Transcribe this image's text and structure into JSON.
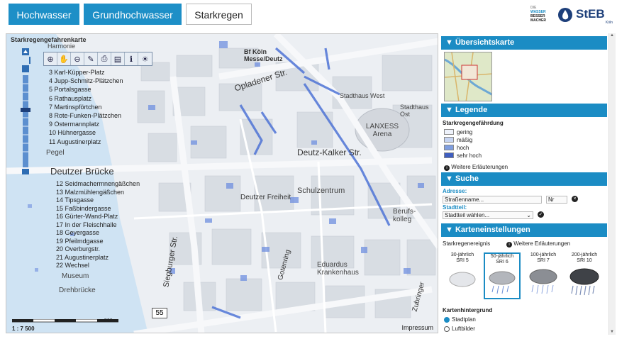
{
  "tabs": [
    {
      "label": "Hochwasser",
      "active": true
    },
    {
      "label": "Grundhochwasser",
      "active": true
    },
    {
      "label": "Starkregen",
      "active": false
    }
  ],
  "logos": {
    "left": [
      "DIE",
      "WASSER",
      "BESSER",
      "MACHER"
    ],
    "right": "StEB",
    "right_sub": "Köln"
  },
  "map": {
    "title": "Starkregengefahrenkarte",
    "toolbar_icons": [
      "zoom-in-icon",
      "pan-hand-icon",
      "zoom-out-icon",
      "measure-icon",
      "print-icon",
      "layers-icon",
      "info-icon",
      "light-bulb-icon"
    ],
    "legend_list_1": [
      "3 Karl-Küpper-Platz",
      "4 Jupp-Schmitz-Plätzchen",
      "5 Portalsgasse",
      "6 Rathausplatz",
      "7 Martinspförtchen",
      "8 Rote-Funken-Plätzchen",
      "9 Ostermannplatz",
      "10 Hühnergasse",
      "11 Augustinerplatz"
    ],
    "legend_list_2": [
      "12 Seidmachermnengäßchen",
      "13 Malzmühlengäßchen",
      "14 Tipsgasse",
      "15 Faßbindergasse",
      "16 Gürter-Wand-Platz",
      "17 In der Fleischhalle",
      "18 Geyergasse",
      "19 Pfeilmdgasse",
      "20 Overburgstr.",
      "21 Augustinerplatz",
      "22 Wechsel"
    ],
    "labels": [
      {
        "text": "Deutzer Brücke"
      },
      {
        "text": "Deutz-Kalker Str."
      },
      {
        "text": "Opladener Str."
      },
      {
        "text": "LANXESS Arena"
      },
      {
        "text": "Schulzentrum"
      },
      {
        "text": "Eduardus Krankenhaus"
      },
      {
        "text": "Museum"
      },
      {
        "text": "Drehbrücke"
      },
      {
        "text": "Siegburger Str."
      },
      {
        "text": "Deutzer Freiheit"
      },
      {
        "text": "Stadthaus West"
      },
      {
        "text": "Stadthaus Ost"
      },
      {
        "text": "Berufs-kolleg"
      },
      {
        "text": "Gotenring"
      },
      {
        "text": "Zubringer"
      },
      {
        "text": "Harmonie"
      },
      {
        "text": "Bf Köln Messe/Deutz"
      },
      {
        "text": "Pegel"
      },
      {
        "text": "55"
      }
    ],
    "scale_text": "1 : 7 500",
    "scale_unit": "500 m",
    "impressum": "Impressum"
  },
  "sidebar": {
    "overview": {
      "title": "Übersichtskarte"
    },
    "legend": {
      "title": "Legende",
      "heading": "Starkregengefährdung",
      "items": [
        {
          "label": "gering",
          "color": "#eef2fb"
        },
        {
          "label": "mäßig",
          "color": "#c6d4f2"
        },
        {
          "label": "hoch",
          "color": "#7f9ee0"
        },
        {
          "label": "sehr hoch",
          "color": "#3f5ec0"
        }
      ],
      "more": "Weitere Erläuterungen"
    },
    "search": {
      "title": "Suche",
      "address_label": "Adresse:",
      "street_placeholder": "Straßenname...",
      "nr_placeholder": "Nr",
      "district_label": "Stadtteil:",
      "district_value": "Stadtteil wählen..."
    },
    "settings": {
      "title": "Karteneinstellungen",
      "event_label": "Starkregenereignis",
      "more": "Weitere Erläuterungen",
      "events": [
        {
          "label": "30-jährlich",
          "sub": "SRI 5",
          "selected": false
        },
        {
          "label": "50-jährlich",
          "sub": "SRI 6",
          "selected": true
        },
        {
          "label": "100-jährlich",
          "sub": "SRI 7",
          "selected": false
        },
        {
          "label": "200-jährlich",
          "sub": "SRI 10",
          "selected": false
        }
      ],
      "background_label": "Kartenhintergrund",
      "bg_options": [
        {
          "label": "Stadtplan",
          "selected": true
        },
        {
          "label": "Luftbilder",
          "selected": false
        }
      ]
    }
  }
}
